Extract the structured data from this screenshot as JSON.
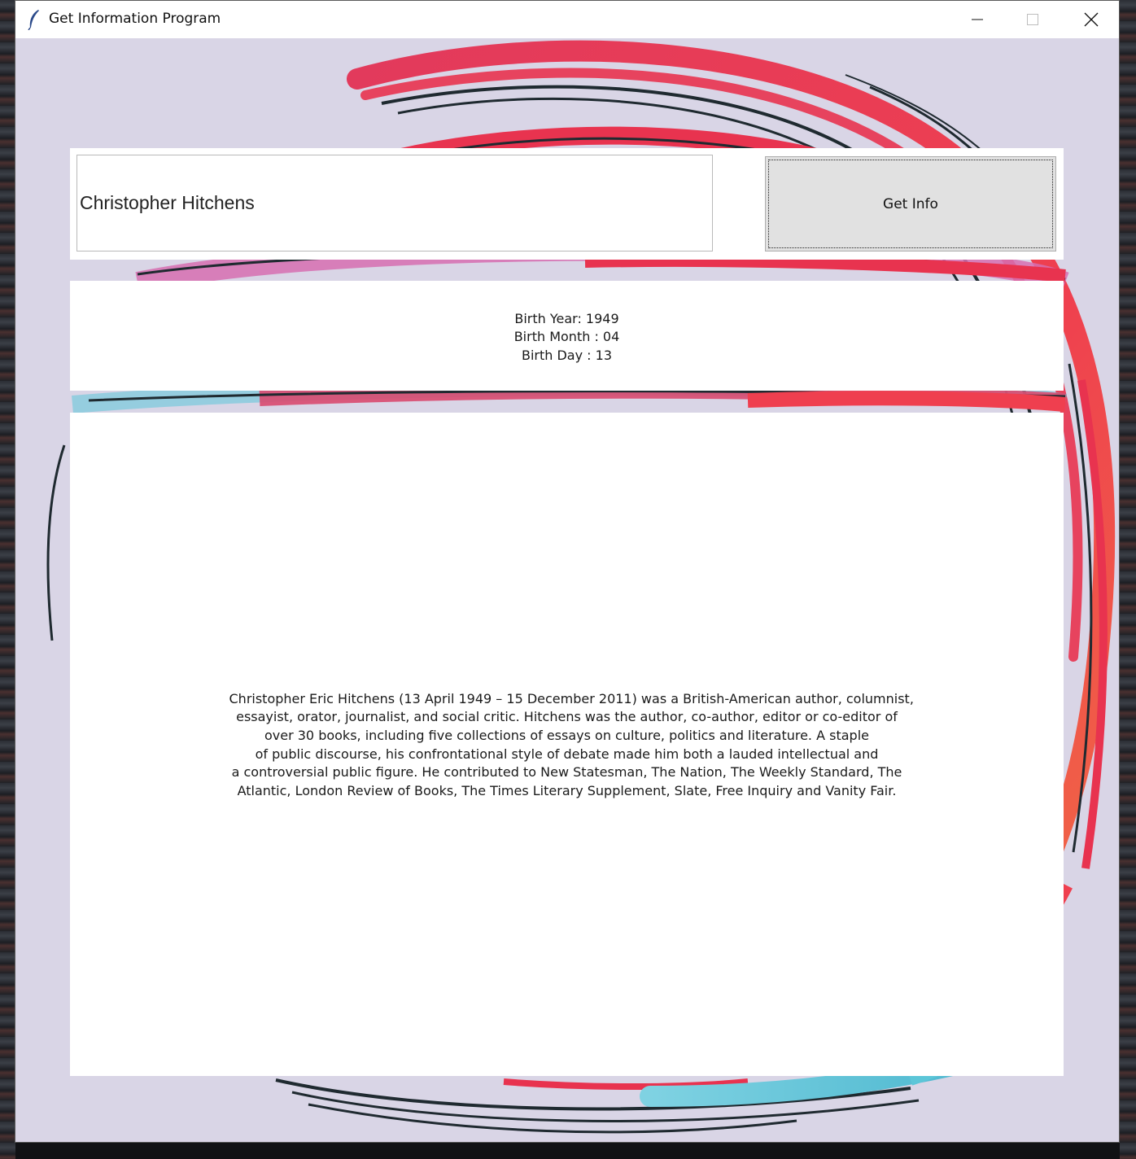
{
  "window": {
    "title": "Get Information Program",
    "icon": "feather-icon",
    "controls": [
      "minimize-icon",
      "maximize-icon",
      "close-icon"
    ]
  },
  "search": {
    "value": "Christopher Hitchens",
    "button_label": "Get Info"
  },
  "birth": {
    "year": "Birth Year: 1949",
    "month": "Birth Month : 04",
    "day": "Birth Day : 13"
  },
  "summary": {
    "lines": [
      "Christopher Eric Hitchens (13 April 1949 – 15 December 2011) was a British-American author, columnist,",
      "essayist, orator, journalist, and social critic. Hitchens was the author, co-author, editor or co-editor of",
      "over 30 books, including five collections of essays on culture, politics and literature. A staple",
      "of public discourse, his confrontational style of debate made him both a lauded intellectual and",
      "a controversial public figure. He contributed to New Statesman, The Nation, The Weekly Standard, The",
      "Atlantic, London Review of Books, The Times Literary Supplement, Slate, Free Inquiry and Vanity Fair."
    ]
  },
  "colors": {
    "background_art": "#d9d5e6",
    "ring_red": "#e8334f",
    "ring_dark": "#1f2a30",
    "ring_cyan": "#5cc6d8",
    "ring_pink": "#d66fb0",
    "button_face": "#e1e1e1"
  }
}
